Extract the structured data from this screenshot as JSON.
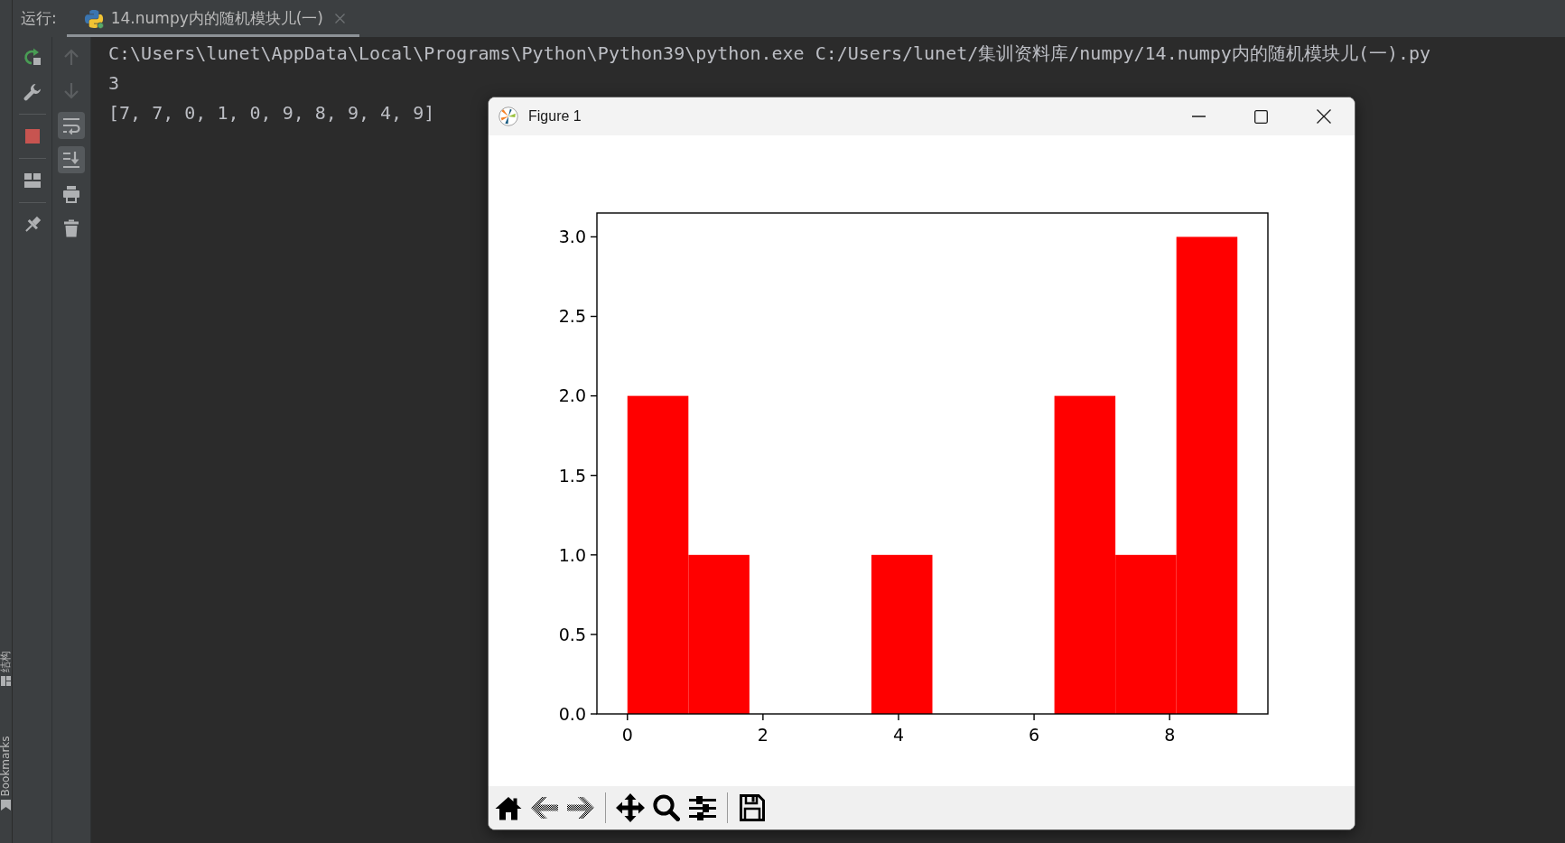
{
  "left_stripe": {
    "buttons": [
      {
        "label": "结构"
      },
      {
        "label": "Bookmarks"
      }
    ]
  },
  "run_panel": {
    "label": "运行:",
    "tabs": [
      {
        "title": "14.numpy内的随机模块儿(一)",
        "selected": true
      }
    ]
  },
  "console_toolbar": [
    {
      "disabled": true,
      "on": false
    },
    {
      "disabled": true,
      "on": false
    },
    {
      "disabled": false,
      "on": true
    },
    {
      "disabled": false,
      "on": true
    },
    {
      "disabled": false,
      "on": false
    },
    {
      "disabled": false,
      "on": false
    }
  ],
  "console": {
    "lines": [
      "C:\\Users\\lunet\\AppData\\Local\\Programs\\Python\\Python39\\python.exe C:/Users/lunet/集训资料库/numpy/14.numpy内的随机模块儿(一).py",
      "3",
      "[7, 7, 0, 1, 0, 9, 8, 9, 4, 9]"
    ]
  },
  "figure_window": {
    "title": "Figure 1",
    "chart_data": {
      "type": "bar",
      "x": [
        0.45,
        1.35,
        2.25,
        3.15,
        4.05,
        4.95,
        5.85,
        6.75,
        7.65,
        8.55
      ],
      "series": [
        {
          "color": "#ff0000",
          "values": [
            2,
            1,
            0,
            0,
            1,
            0,
            0,
            2,
            1,
            3
          ]
        }
      ],
      "xlim": [
        -0.45,
        9.45
      ],
      "ylim": [
        0,
        3.15
      ],
      "xticks": [
        {
          "value": 0,
          "label": "0"
        },
        {
          "value": 2,
          "label": "2"
        },
        {
          "value": 4,
          "label": "4"
        },
        {
          "value": 6,
          "label": "6"
        },
        {
          "value": 8,
          "label": "8"
        }
      ],
      "yticks": [
        {
          "value": 0,
          "label": "0.0"
        },
        {
          "value": 0.5,
          "label": "0.5"
        },
        {
          "value": 1,
          "label": "1.0"
        },
        {
          "value": 1.5,
          "label": "1.5"
        },
        {
          "value": 2,
          "label": "2.0"
        },
        {
          "value": 2.5,
          "label": "2.5"
        },
        {
          "value": 3,
          "label": "3.0"
        }
      ]
    },
    "toolbar_groups": [
      {
        "buttons": [
          {
            "disabled": false
          },
          {
            "disabled": true
          },
          {
            "disabled": true
          }
        ]
      },
      {
        "buttons": [
          {
            "disabled": false
          },
          {
            "disabled": false
          },
          {
            "disabled": false
          }
        ]
      },
      {
        "buttons": [
          {
            "disabled": false
          }
        ]
      }
    ]
  }
}
